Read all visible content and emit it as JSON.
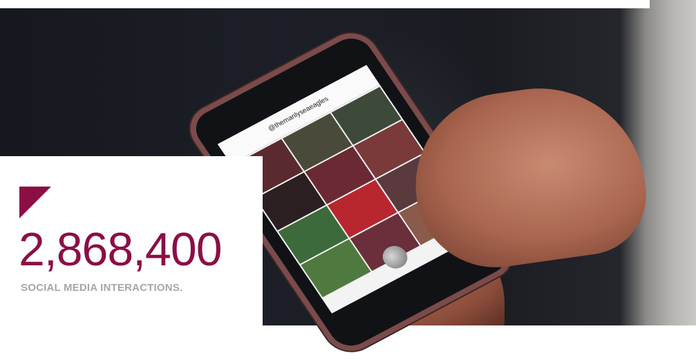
{
  "stat": {
    "value": "2,868,400",
    "label": "SOCIAL MEDIA INTERACTIONS."
  },
  "colors": {
    "accent": "#8b0f45",
    "caption": "#a6a6a6",
    "background": "#ffffff"
  },
  "phone_screen": {
    "header": "@themanlyseaeagles"
  },
  "icons": [
    "corner-triangle-accent"
  ]
}
